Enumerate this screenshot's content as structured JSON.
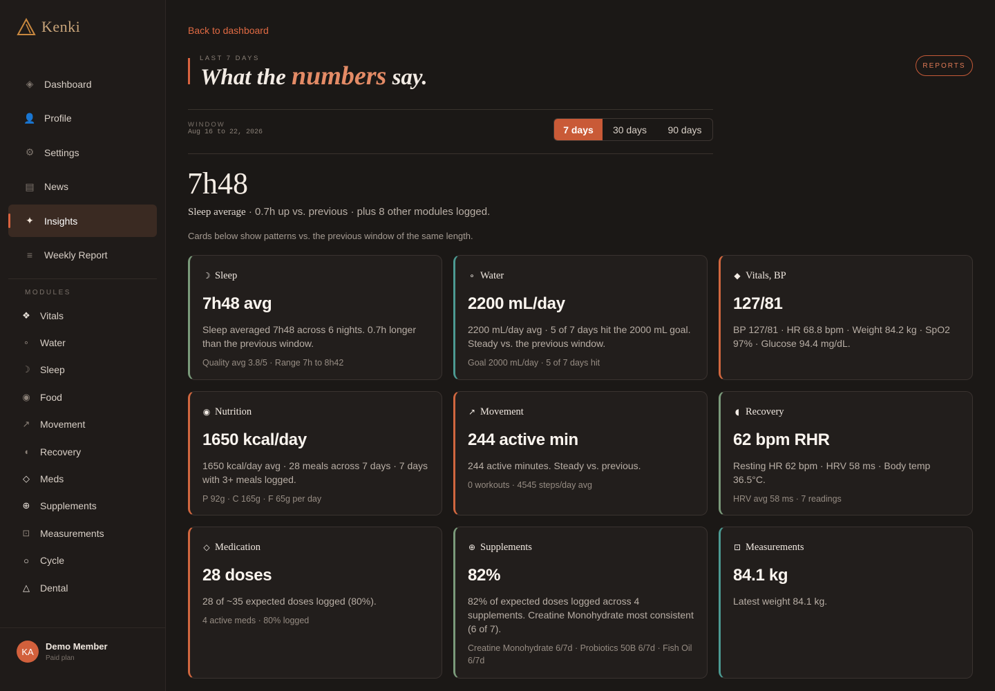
{
  "app": {
    "name": "Kenki"
  },
  "sidebar": {
    "nav": [
      {
        "label": "Dashboard",
        "icon": "◈",
        "name": "dashboard"
      },
      {
        "label": "Profile",
        "icon": "👤",
        "name": "profile"
      },
      {
        "label": "Settings",
        "icon": "⚙",
        "name": "settings"
      },
      {
        "label": "News",
        "icon": "▤",
        "name": "news"
      },
      {
        "label": "Insights",
        "icon": "✦",
        "name": "insights",
        "active": true
      },
      {
        "label": "Weekly Report",
        "icon": "≡",
        "name": "weekly-report"
      }
    ],
    "modules_label": "MODULES",
    "modules": [
      {
        "label": "Vitals",
        "icon": "❖",
        "name": "vitals",
        "bright": true
      },
      {
        "label": "Water",
        "icon": "∘",
        "name": "water"
      },
      {
        "label": "Sleep",
        "icon": "☽",
        "name": "sleep"
      },
      {
        "label": "Food",
        "icon": "◉",
        "name": "food"
      },
      {
        "label": "Movement",
        "icon": "↗",
        "name": "movement"
      },
      {
        "label": "Recovery",
        "icon": "◖",
        "name": "recovery"
      },
      {
        "label": "Meds",
        "icon": "◇",
        "name": "meds",
        "bright": true
      },
      {
        "label": "Supplements",
        "icon": "⊕",
        "name": "supplements",
        "bright": true
      },
      {
        "label": "Measurements",
        "icon": "⊡",
        "name": "measurements"
      },
      {
        "label": "Cycle",
        "icon": "○",
        "name": "cycle",
        "bright": true
      },
      {
        "label": "Dental",
        "icon": "△",
        "name": "dental",
        "bright": true
      }
    ],
    "user": {
      "initials": "KA",
      "name": "Demo Member",
      "plan": "Paid plan"
    }
  },
  "header": {
    "back_label": "Back to dashboard",
    "eyebrow": "LAST 7 DAYS",
    "title_pre": "What the",
    "title_accent": "numbers",
    "title_post": "say.",
    "reports_label": "REPORTS"
  },
  "window": {
    "label": "WINDOW",
    "range": "Aug 16 to 22, 2026",
    "options": [
      "7 days",
      "30 days",
      "90 days"
    ],
    "selected": "7 days"
  },
  "hero": {
    "value": "7h48",
    "summary_label": "Sleep average",
    "summary_rest": " · 0.7h up vs. previous · plus 8 other modules logged.",
    "note": "Cards below show patterns vs. the previous window of the same length."
  },
  "accent_colors": {
    "primary": "#d9633f",
    "green": "#7a9a7a",
    "teal": "#4c9a92"
  },
  "cards": [
    {
      "name": "sleep",
      "icon": "☽",
      "title": "Sleep",
      "value": "7h48 avg",
      "desc": "Sleep averaged 7h48 across 6 nights. 0.7h longer than the previous window.",
      "meta": "Quality avg 3.8/5 · Range 7h to 8h42",
      "color": "green"
    },
    {
      "name": "water",
      "icon": "∘",
      "title": "Water",
      "value": "2200 mL/day",
      "desc": "2200 mL/day avg · 5 of 7 days hit the 2000 mL goal. Steady vs. the previous window.",
      "meta": "Goal 2000 mL/day · 5 of 7 days hit",
      "color": "teal"
    },
    {
      "name": "vitals",
      "icon": "◆",
      "title": "Vitals, BP",
      "value": "127/81",
      "desc": "BP 127/81 · HR 68.8 bpm · Weight 84.2 kg · SpO2 97% · Glucose 94.4 mg/dL.",
      "meta": "",
      "color": "orange"
    },
    {
      "name": "nutrition",
      "icon": "◉",
      "title": "Nutrition",
      "value": "1650 kcal/day",
      "desc": "1650 kcal/day avg · 28 meals across 7 days · 7 days with 3+ meals logged.",
      "meta": "P 92g · C 165g · F 65g per day",
      "color": "orange"
    },
    {
      "name": "movement",
      "icon": "↗",
      "title": "Movement",
      "value": "244 active min",
      "desc": "244 active minutes. Steady vs. previous.",
      "meta": "0 workouts · 4545 steps/day avg",
      "color": "orange"
    },
    {
      "name": "recovery",
      "icon": "◖",
      "title": "Recovery",
      "value": "62 bpm RHR",
      "desc": "Resting HR 62 bpm · HRV 58 ms · Body temp 36.5°C.",
      "meta": "HRV avg 58 ms · 7 readings",
      "color": "green"
    },
    {
      "name": "medication",
      "icon": "◇",
      "title": "Medication",
      "value": "28 doses",
      "desc": "28 of ~35 expected doses logged (80%).",
      "meta": "4 active meds · 80% logged",
      "color": "orange"
    },
    {
      "name": "supplements",
      "icon": "⊕",
      "title": "Supplements",
      "value": "82%",
      "desc": "82% of expected doses logged across 4 supplements. Creatine Monohydrate most consistent (6 of 7).",
      "meta": "Creatine Monohydrate 6/7d · Probiotics 50B 6/7d · Fish Oil 6/7d",
      "color": "green"
    },
    {
      "name": "measurements",
      "icon": "⊡",
      "title": "Measurements",
      "value": "84.1 kg",
      "desc": "Latest weight 84.1 kg.",
      "meta": "",
      "color": "teal"
    }
  ]
}
